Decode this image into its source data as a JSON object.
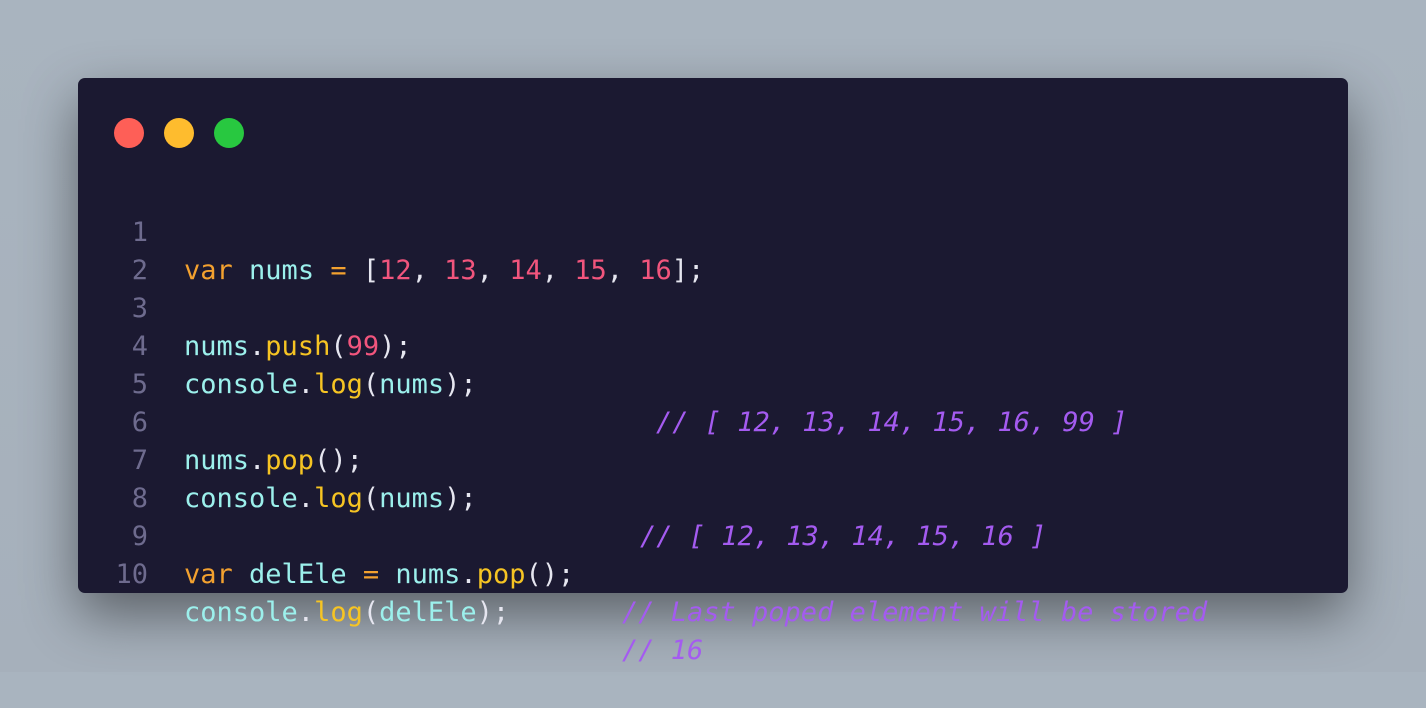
{
  "window": {
    "dots": [
      {
        "name": "close",
        "color": "#fe5f57"
      },
      {
        "name": "minimize",
        "color": "#febc2e"
      },
      {
        "name": "maximize",
        "color": "#28c840"
      }
    ]
  },
  "code": {
    "lines": [
      {
        "number": "1",
        "tokens": [
          {
            "t": "var",
            "k": "kw"
          },
          {
            "t": " ",
            "k": "pun"
          },
          {
            "t": "nums",
            "k": "id"
          },
          {
            "t": " ",
            "k": "pun"
          },
          {
            "t": "=",
            "k": "op"
          },
          {
            "t": " [",
            "k": "pun"
          },
          {
            "t": "12",
            "k": "num"
          },
          {
            "t": ", ",
            "k": "pun"
          },
          {
            "t": "13",
            "k": "num"
          },
          {
            "t": ", ",
            "k": "pun"
          },
          {
            "t": "14",
            "k": "num"
          },
          {
            "t": ", ",
            "k": "pun"
          },
          {
            "t": "15",
            "k": "num"
          },
          {
            "t": ", ",
            "k": "pun"
          },
          {
            "t": "16",
            "k": "num"
          },
          {
            "t": "];",
            "k": "pun"
          }
        ],
        "comment": ""
      },
      {
        "number": "2",
        "tokens": [],
        "comment": ""
      },
      {
        "number": "3",
        "tokens": [
          {
            "t": "nums",
            "k": "id"
          },
          {
            "t": ".",
            "k": "pun"
          },
          {
            "t": "push",
            "k": "fn"
          },
          {
            "t": "(",
            "k": "pun"
          },
          {
            "t": "99",
            "k": "num"
          },
          {
            "t": ");",
            "k": "pun"
          }
        ],
        "comment": ""
      },
      {
        "number": "4",
        "tokens": [
          {
            "t": "console",
            "k": "id"
          },
          {
            "t": ".",
            "k": "pun"
          },
          {
            "t": "log",
            "k": "fn"
          },
          {
            "t": "(",
            "k": "pun"
          },
          {
            "t": "nums",
            "k": "id"
          },
          {
            "t": ");",
            "k": "pun"
          }
        ],
        "comment": "// [ 12, 13, 14, 15, 16, 99 ]"
      },
      {
        "number": "5",
        "tokens": [],
        "comment": ""
      },
      {
        "number": "6",
        "tokens": [
          {
            "t": "nums",
            "k": "id"
          },
          {
            "t": ".",
            "k": "pun"
          },
          {
            "t": "pop",
            "k": "fn"
          },
          {
            "t": "();",
            "k": "pun"
          }
        ],
        "comment": ""
      },
      {
        "number": "7",
        "tokens": [
          {
            "t": "console",
            "k": "id"
          },
          {
            "t": ".",
            "k": "pun"
          },
          {
            "t": "log",
            "k": "fn"
          },
          {
            "t": "(",
            "k": "pun"
          },
          {
            "t": "nums",
            "k": "id"
          },
          {
            "t": ");",
            "k": "pun"
          }
        ],
        "comment": "// [ 12, 13, 14, 15, 16 ]"
      },
      {
        "number": "8",
        "tokens": [],
        "comment": ""
      },
      {
        "number": "9",
        "tokens": [
          {
            "t": "var",
            "k": "kw"
          },
          {
            "t": " ",
            "k": "pun"
          },
          {
            "t": "delEle",
            "k": "id"
          },
          {
            "t": " ",
            "k": "pun"
          },
          {
            "t": "=",
            "k": "op"
          },
          {
            "t": " ",
            "k": "pun"
          },
          {
            "t": "nums",
            "k": "id"
          },
          {
            "t": ".",
            "k": "pun"
          },
          {
            "t": "pop",
            "k": "fn"
          },
          {
            "t": "();",
            "k": "pun"
          }
        ],
        "comment": "// Last poped element will be stored"
      },
      {
        "number": "10",
        "tokens": [
          {
            "t": "console",
            "k": "id"
          },
          {
            "t": ".",
            "k": "pun"
          },
          {
            "t": "log",
            "k": "fn"
          },
          {
            "t": "(",
            "k": "pun"
          },
          {
            "t": "delEle",
            "k": "id"
          },
          {
            "t": ");",
            "k": "pun"
          }
        ],
        "comment": "// 16"
      }
    ]
  }
}
